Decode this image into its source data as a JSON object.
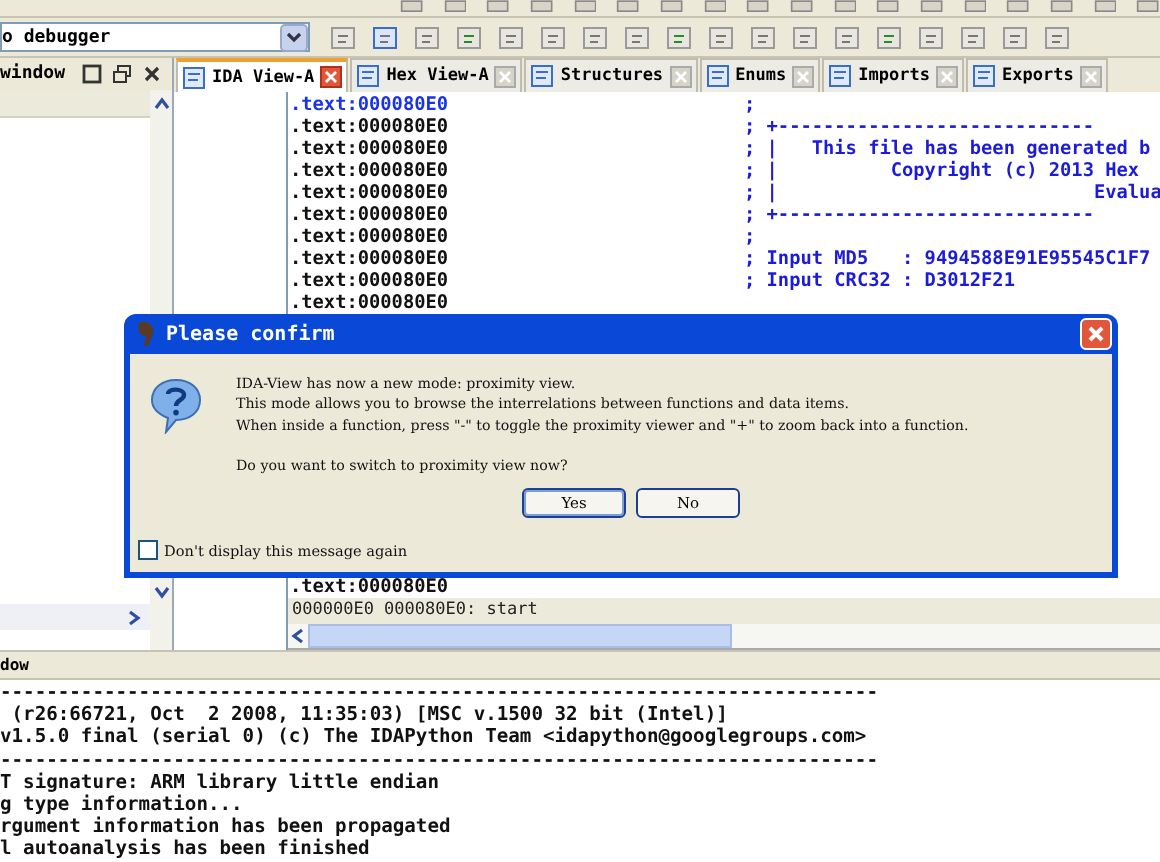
{
  "toolbar": {
    "debugger": "o debugger"
  },
  "side_panel": {
    "title": "window"
  },
  "tabs": [
    {
      "label": "IDA View-A",
      "selected": true
    },
    {
      "label": "Hex View-A",
      "selected": false
    },
    {
      "label": "Structures",
      "selected": false
    },
    {
      "label": "Enums",
      "selected": false
    },
    {
      "label": "Imports",
      "selected": false
    },
    {
      "label": "Exports",
      "selected": false
    }
  ],
  "listing": {
    "rows": [
      {
        "address": ".text:000080E0",
        "comment": ";",
        "current": true
      },
      {
        "address": ".text:000080E0",
        "comment": "; +----------------------------",
        "current": false
      },
      {
        "address": ".text:000080E0",
        "comment": "; |   This file has been generated b",
        "current": false
      },
      {
        "address": ".text:000080E0",
        "comment": "; |          Copyright (c) 2013 Hex",
        "current": false
      },
      {
        "address": ".text:000080E0",
        "comment": "; |                            Evalua",
        "current": false
      },
      {
        "address": ".text:000080E0",
        "comment": "; +----------------------------",
        "current": false
      },
      {
        "address": ".text:000080E0",
        "comment": ";",
        "current": false
      },
      {
        "address": ".text:000080E0",
        "comment": "; Input MD5   : 9494588E91E95545C1F7",
        "current": false
      },
      {
        "address": ".text:000080E0",
        "comment": "; Input CRC32 : D3012F21",
        "current": false
      },
      {
        "address": ".text:000080E0",
        "comment": "",
        "current": false
      }
    ],
    "last_row": ".text:000080E0",
    "status": "000000E0 000080E0: start"
  },
  "output_panel": {
    "title": "dow",
    "lines": [
      "----------------------------------------------------------------------------",
      " (r26:66721, Oct  2 2008, 11:35:03) [MSC v.1500 32 bit (Intel)]",
      "v1.5.0 final (serial 0) (c) The IDAPython Team <idapython@googlegroups.com>",
      "----------------------------------------------------------------------------",
      "T signature: ARM library little endian",
      "g type information...",
      "rgument information has been propagated",
      "l autoanalysis has been finished"
    ]
  },
  "dialog": {
    "title": "Please confirm",
    "message": [
      "IDA-View has now a new mode: proximity view.",
      "This mode allows you to browse the interrelations between functions and data items.",
      "When inside a function, press \"-\" to toggle the proximity viewer and \"+\" to zoom back into a function."
    ],
    "question": "Do you want to switch to proximity view now?",
    "buttons": [
      {
        "label": "Yes",
        "selected": true
      },
      {
        "label": "No",
        "selected": false
      }
    ],
    "checkbox": {
      "label": "Don't display this message again",
      "checked": false
    }
  }
}
